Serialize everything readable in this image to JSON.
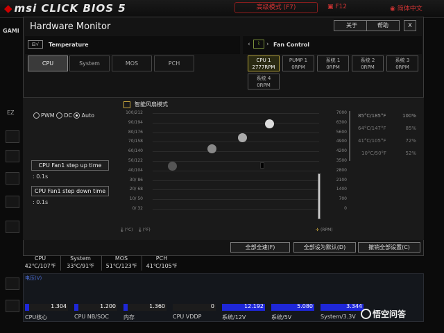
{
  "app": {
    "logo": "msi CLICK BIOS 5",
    "advanced_mode": "高级模式 (F7)",
    "f12": "F12",
    "language": "简体中文",
    "gam_label": "GAMI",
    "ez_label": "EZ"
  },
  "window": {
    "title": "Hardware Monitor",
    "about": "关于",
    "help": "帮助",
    "close": "X"
  },
  "temperature": {
    "label": "Temperature",
    "tabs": [
      "CPU",
      "System",
      "MOS",
      "PCH"
    ],
    "active_tab": "CPU"
  },
  "fan_control": {
    "label": "Fan Control",
    "fans": [
      {
        "name": "CPU 1",
        "rpm": "2777RPM",
        "active": true
      },
      {
        "name": "PUMP 1",
        "rpm": "0RPM"
      },
      {
        "name": "系统 1",
        "rpm": "0RPM"
      },
      {
        "name": "系统 2",
        "rpm": "0RPM"
      },
      {
        "name": "系统 3",
        "rpm": "0RPM"
      },
      {
        "name": "系统 4",
        "rpm": "0RPM"
      }
    ]
  },
  "mode": {
    "options": [
      "PWM",
      "DC",
      "Auto"
    ],
    "selected": "Auto"
  },
  "step_up": {
    "label": "CPU Fan1 step up time",
    "value": ": 0.1s"
  },
  "step_down": {
    "label": "CPU Fan1 step down time",
    "value": ": 0.1s"
  },
  "smart_fan": {
    "label": "智能风扇模式",
    "left_axis": [
      "100/212",
      "90/194",
      "80/176",
      "70/158",
      "60/140",
      "50/122",
      "40/104",
      "30/ 86",
      "20/ 68",
      "10/ 50",
      "0/ 32"
    ],
    "right_axis": [
      "7000",
      "6300",
      "5600",
      "4900",
      "4200",
      "3500",
      "2800",
      "2100",
      "1400",
      "700",
      "0"
    ],
    "temp_unit_c": "(°C)",
    "temp_unit_f": "(°F)",
    "rpm_unit": "(RPM)",
    "legend": [
      {
        "temp": "85°C/185°F",
        "pct": "100%"
      },
      {
        "temp": "64°C/147°F",
        "pct": "85%"
      },
      {
        "temp": "41°C/105°F",
        "pct": "72%"
      },
      {
        "temp": "10°C/50°F",
        "pct": "52%"
      }
    ]
  },
  "buttons": {
    "full_speed": "全部全速(F)",
    "default_all": "全部设为默认(D)",
    "cancel_all": "撤销全部设置(C)"
  },
  "summary": [
    {
      "name": "CPU",
      "value": "42℃/107℉"
    },
    {
      "name": "System",
      "value": "33℃/91℉"
    },
    {
      "name": "MOS",
      "value": "51℃/123℉"
    },
    {
      "name": "PCH",
      "value": "41℃/105℉"
    }
  ],
  "voltage": {
    "title": "电压(V)",
    "items": [
      {
        "label": "CPU核心",
        "value": "1.304",
        "fill": 0.1
      },
      {
        "label": "CPU NB/SOC",
        "value": "1.200",
        "fill": 0.1
      },
      {
        "label": "内存",
        "value": "1.360",
        "fill": 0.1
      },
      {
        "label": "CPU VDDP",
        "value": "0",
        "fill": 0.0
      },
      {
        "label": "系统/12V",
        "value": "12.192",
        "fill": 1.0
      },
      {
        "label": "系统/5V",
        "value": "5.080",
        "fill": 1.0
      },
      {
        "label": "System/3.3V",
        "value": "3.344",
        "fill": 1.0
      }
    ]
  },
  "watermark": "悟空问答"
}
